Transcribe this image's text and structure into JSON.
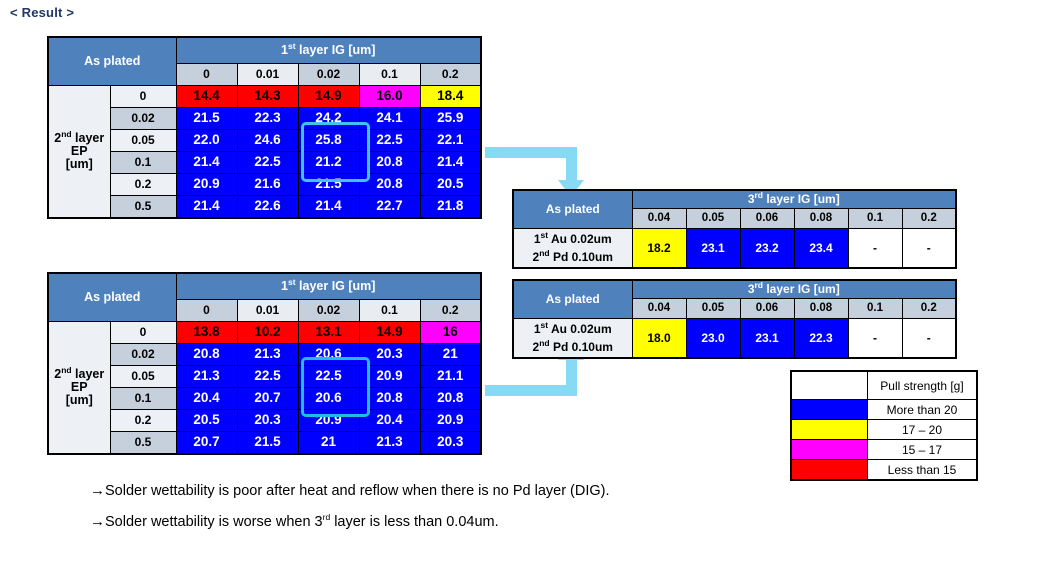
{
  "page": {
    "title": "< Result >"
  },
  "tables": {
    "left_top": {
      "corner_label": "As plated",
      "col_group_header": "1st layer IG [um]",
      "col_group_header_base": "1",
      "col_group_header_sup": "st",
      "col_group_header_rest": " layer IG [um]",
      "row_group_label_lines": [
        "2nd layer",
        "EP",
        "[um]"
      ],
      "row_group_base": "2",
      "row_group_sup": "nd",
      "row_group_rest": " layer",
      "columns": [
        "0",
        "0.01",
        "0.02",
        "0.1",
        "0.2"
      ],
      "rows": [
        {
          "label": "0",
          "cells": [
            {
              "v": "14.4",
              "c": "red"
            },
            {
              "v": "14.3",
              "c": "red"
            },
            {
              "v": "14.9",
              "c": "red"
            },
            {
              "v": "16.0",
              "c": "magenta"
            },
            {
              "v": "18.4",
              "c": "yellow"
            }
          ]
        },
        {
          "label": "0.02",
          "cells": [
            {
              "v": "21.5",
              "c": "blue"
            },
            {
              "v": "22.3",
              "c": "blue"
            },
            {
              "v": "24.2",
              "c": "blue"
            },
            {
              "v": "24.1",
              "c": "blue"
            },
            {
              "v": "25.9",
              "c": "blue"
            }
          ]
        },
        {
          "label": "0.05",
          "cells": [
            {
              "v": "22.0",
              "c": "blue"
            },
            {
              "v": "24.6",
              "c": "blue"
            },
            {
              "v": "25.8",
              "c": "blue"
            },
            {
              "v": "22.5",
              "c": "blue"
            },
            {
              "v": "22.1",
              "c": "blue"
            }
          ]
        },
        {
          "label": "0.1",
          "cells": [
            {
              "v": "21.4",
              "c": "blue"
            },
            {
              "v": "22.5",
              "c": "blue"
            },
            {
              "v": "21.2",
              "c": "blue"
            },
            {
              "v": "20.8",
              "c": "blue"
            },
            {
              "v": "21.4",
              "c": "blue"
            }
          ]
        },
        {
          "label": "0.2",
          "cells": [
            {
              "v": "20.9",
              "c": "blue"
            },
            {
              "v": "21.6",
              "c": "blue"
            },
            {
              "v": "21.5",
              "c": "blue"
            },
            {
              "v": "20.8",
              "c": "blue"
            },
            {
              "v": "20.5",
              "c": "blue"
            }
          ]
        },
        {
          "label": "0.5",
          "cells": [
            {
              "v": "21.4",
              "c": "blue"
            },
            {
              "v": "22.6",
              "c": "blue"
            },
            {
              "v": "21.4",
              "c": "blue"
            },
            {
              "v": "22.7",
              "c": "blue"
            },
            {
              "v": "21.8",
              "c": "blue"
            }
          ]
        }
      ]
    },
    "left_bottom": {
      "corner_label": "As plated",
      "col_group_header": "1st layer IG [um]",
      "col_group_header_base": "1",
      "col_group_header_sup": "st",
      "col_group_header_rest": " layer IG [um]",
      "row_group_base": "2",
      "row_group_sup": "nd",
      "row_group_rest": " layer",
      "columns": [
        "0",
        "0.01",
        "0.02",
        "0.1",
        "0.2"
      ],
      "rows": [
        {
          "label": "0",
          "cells": [
            {
              "v": "13.8",
              "c": "red"
            },
            {
              "v": "10.2",
              "c": "red"
            },
            {
              "v": "13.1",
              "c": "red"
            },
            {
              "v": "14.9",
              "c": "red"
            },
            {
              "v": "16",
              "c": "magenta"
            }
          ]
        },
        {
          "label": "0.02",
          "cells": [
            {
              "v": "20.8",
              "c": "blue"
            },
            {
              "v": "21.3",
              "c": "blue"
            },
            {
              "v": "20.6",
              "c": "blue"
            },
            {
              "v": "20.3",
              "c": "blue"
            },
            {
              "v": "21",
              "c": "blue"
            }
          ]
        },
        {
          "label": "0.05",
          "cells": [
            {
              "v": "21.3",
              "c": "blue"
            },
            {
              "v": "22.5",
              "c": "blue"
            },
            {
              "v": "22.5",
              "c": "blue"
            },
            {
              "v": "20.9",
              "c": "blue"
            },
            {
              "v": "21.1",
              "c": "blue"
            }
          ]
        },
        {
          "label": "0.1",
          "cells": [
            {
              "v": "20.4",
              "c": "blue"
            },
            {
              "v": "20.7",
              "c": "blue"
            },
            {
              "v": "20.6",
              "c": "blue"
            },
            {
              "v": "20.8",
              "c": "blue"
            },
            {
              "v": "20.8",
              "c": "blue"
            }
          ]
        },
        {
          "label": "0.2",
          "cells": [
            {
              "v": "20.5",
              "c": "blue"
            },
            {
              "v": "20.3",
              "c": "blue"
            },
            {
              "v": "20.9",
              "c": "blue"
            },
            {
              "v": "20.4",
              "c": "blue"
            },
            {
              "v": "20.9",
              "c": "blue"
            }
          ]
        },
        {
          "label": "0.5",
          "cells": [
            {
              "v": "20.7",
              "c": "blue"
            },
            {
              "v": "21.5",
              "c": "blue"
            },
            {
              "v": "21",
              "c": "blue"
            },
            {
              "v": "21.3",
              "c": "blue"
            },
            {
              "v": "20.3",
              "c": "blue"
            }
          ]
        }
      ]
    },
    "right_top": {
      "corner_label": "As plated",
      "col_group_header_base": "3",
      "col_group_header_sup": "rd",
      "col_group_header_rest": " layer IG [um]",
      "row_label_line1_base": "1",
      "row_label_line1_sup": "st",
      "row_label_line1_rest": " Au 0.02um",
      "row_label_line2_base": "2",
      "row_label_line2_sup": "nd",
      "row_label_line2_rest": " Pd 0.10um",
      "columns": [
        "0.04",
        "0.05",
        "0.06",
        "0.08",
        "0.1",
        "0.2"
      ],
      "cells": [
        {
          "v": "18.2",
          "c": "yellow"
        },
        {
          "v": "23.1",
          "c": "blue"
        },
        {
          "v": "23.2",
          "c": "blue"
        },
        {
          "v": "23.4",
          "c": "blue"
        },
        {
          "v": "-",
          "c": "white"
        },
        {
          "v": "-",
          "c": "white"
        }
      ]
    },
    "right_bottom": {
      "corner_label": "As plated",
      "col_group_header_base": "3",
      "col_group_header_sup": "rd",
      "col_group_header_rest": " layer IG [um]",
      "row_label_line1_base": "1",
      "row_label_line1_sup": "st",
      "row_label_line1_rest": " Au 0.02um",
      "row_label_line2_base": "2",
      "row_label_line2_sup": "nd",
      "row_label_line2_rest": " Pd 0.10um",
      "columns": [
        "0.04",
        "0.05",
        "0.06",
        "0.08",
        "0.1",
        "0.2"
      ],
      "cells": [
        {
          "v": "18.0",
          "c": "yellow"
        },
        {
          "v": "23.0",
          "c": "blue"
        },
        {
          "v": "23.1",
          "c": "blue"
        },
        {
          "v": "22.3",
          "c": "blue"
        },
        {
          "v": "-",
          "c": "white"
        },
        {
          "v": "-",
          "c": "white"
        }
      ]
    }
  },
  "legend": {
    "title": "Pull strength [g]",
    "rows": [
      {
        "color": "#0000FF",
        "label": "More than 20"
      },
      {
        "color": "#FFFF00",
        "label": "17 – 20"
      },
      {
        "color": "#FF00FF",
        "label": "15 – 17"
      },
      {
        "color": "#FF0000",
        "label": "Less than 15"
      }
    ]
  },
  "notes": [
    {
      "arrow": "→",
      "text": "Solder wettability is poor after heat and reflow when there is no Pd layer (DIG)."
    },
    {
      "arrow": "→",
      "prefix": "Solder wettability is worse when 3",
      "sup": "rd",
      "suffix": " layer is less than 0.04um."
    }
  ],
  "colors": {
    "header_blue": "#4F81BD",
    "accent_cyan": "#87DAF4",
    "highlight_box": "#3FC3EF",
    "blue": "#0000FF",
    "red": "#FF0000",
    "yellow": "#FFFF00",
    "magenta": "#FF00FF",
    "title_color": "#1F3864"
  }
}
